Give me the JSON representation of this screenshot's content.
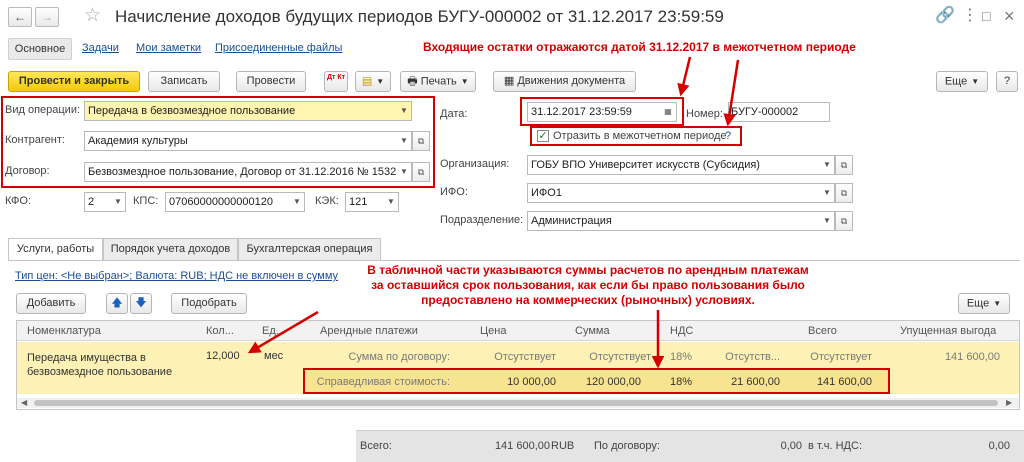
{
  "window": {
    "back_glyph": "←",
    "forward_glyph": "→",
    "title": "Начисление доходов будущих периодов БУГУ-000002 от 31.12.2017 23:59:59",
    "link_glyph": "🔗",
    "menu_glyph": "⋮",
    "maximize_glyph": "□",
    "close_glyph": "×"
  },
  "nav": {
    "main": "Основное",
    "tasks": "Задачи",
    "notes": "Мои заметки",
    "files": "Присоединенные файлы"
  },
  "toolbar": {
    "post_close": "Провести и закрыть",
    "save": "Записать",
    "post": "Провести",
    "dtkt": "Дт Кт",
    "print": "Печать",
    "movements": "Движения документа",
    "more": "Еще"
  },
  "form": {
    "op_type_label": "Вид операции:",
    "op_type_value": "Передача в безвозмездное пользование",
    "counterparty_label": "Контрагент:",
    "counterparty_value": "Академия культуры",
    "contract_label": "Договор:",
    "contract_value": "Безвозмездное пользование, Договор от 31.12.2016 № 1532",
    "kfo_label": "КФО:",
    "kfo_value": "2",
    "kps_label": "КПС:",
    "kps_value": "07060000000000120",
    "kek_label": "КЭК:",
    "kek_value": "121",
    "date_label": "Дата:",
    "date_value": "31.12.2017 23:59:59",
    "number_label": "Номер:",
    "number_value": "БУГУ-000002",
    "reflect_label": "Отразить в межотчетном периоде",
    "help_glyph": "?",
    "org_label": "Организация:",
    "org_value": "ГОБУ ВПО Университет искусств (Субсидия)",
    "ifo_label": "ИФО:",
    "ifo_value": "ИФО1",
    "dept_label": "Подразделение:",
    "dept_value": "Администрация"
  },
  "annotations": {
    "top": "Входящие остатки отражаются датой  31.12.2017 в межотчетном периоде",
    "middle_line1": "В табличной части указываются суммы расчетов по арендным платежам",
    "middle_line2": "за оставшийся срок пользования, как если бы право пользования было",
    "middle_line3": "предоставлено на коммерческих (рыночных) условиях."
  },
  "tabs": [
    {
      "label": "Услуги, работы"
    },
    {
      "label": "Порядок учета доходов"
    },
    {
      "label": "Бухгалтерская операция"
    }
  ],
  "table": {
    "price_type_link": "Тип цен: <Не выбран>; Валюта: RUB; НДС не включен в сумму",
    "add_button": "Добавить",
    "up_glyph": "🡅",
    "down_glyph": "🡇",
    "pick_button": "Подобрать",
    "more_button": "Еще",
    "headers": {
      "nomenclature": "Номенклатура",
      "qty": "Кол...",
      "unit": "Ед...",
      "rent": "Арендные платежи",
      "price": "Цена",
      "sum": "Сумма",
      "vat": "НДС",
      "total": "Всего",
      "lost": "Упущенная выгода"
    },
    "row": {
      "nomenclature_line1": "Передача имущества в",
      "nomenclature_line2": "безвозмездное пользование",
      "qty": "12,000",
      "unit": "мес",
      "contract_label": "Сумма по договору:",
      "contract_price": "Отсутствует",
      "contract_sum": "Отсутствует",
      "contract_vat_rate": "18%",
      "contract_vat": "Отсутств...",
      "contract_total": "Отсутствует",
      "lost": "141 600,00",
      "fair_label": "Справедливая стоимость:",
      "fair_price": "10 000,00",
      "fair_sum": "120 000,00",
      "fair_vat_rate": "18%",
      "fair_vat": "21 600,00",
      "fair_total": "141 600,00"
    }
  },
  "status": {
    "total_label": "Всего:",
    "total_value": "141 600,00",
    "currency": "RUB",
    "by_contract_label": "По договору:",
    "by_contract_value": "0,00",
    "vat_label": "в т.ч. НДС:",
    "vat_value": "0,00"
  },
  "colors": {
    "annotation_red": "#d40000",
    "primary_button": "#f4c80e",
    "selected_row": "#fdf1b6",
    "link_blue": "#1a4e96"
  }
}
